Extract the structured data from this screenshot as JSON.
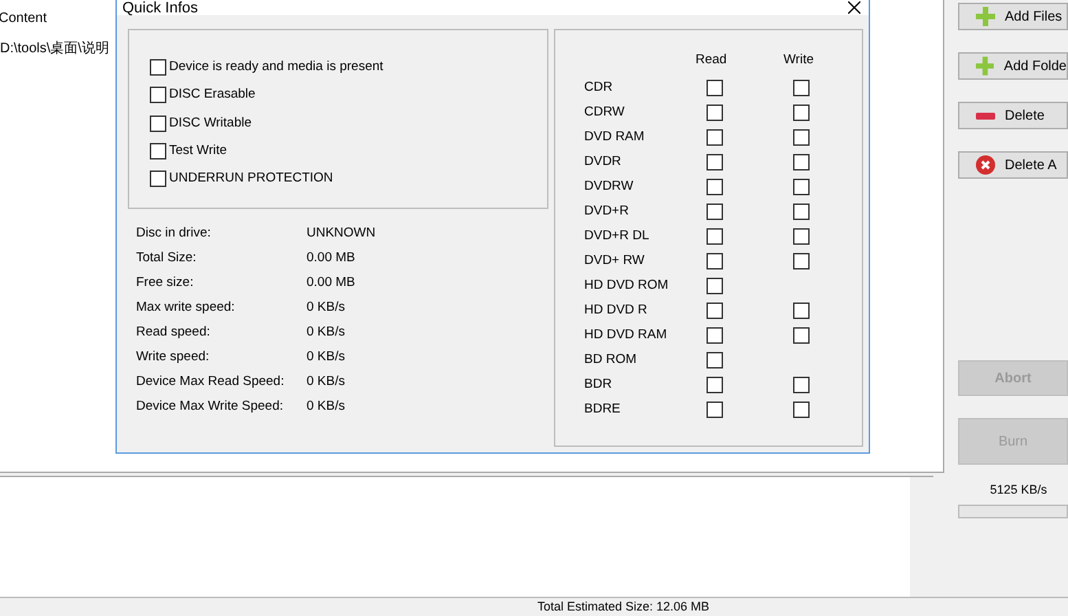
{
  "main_list": {
    "column_header": "Content",
    "rows": [
      "D:\\tools\\桌面\\说明"
    ]
  },
  "sidebar_buttons": [
    {
      "label": "Add Files",
      "kind": "add"
    },
    {
      "label": "Add Folde",
      "kind": "add"
    },
    {
      "label": "Delete",
      "kind": "delete"
    },
    {
      "label": "Delete A",
      "kind": "clear"
    }
  ],
  "action_buttons": [
    {
      "label": "Abort",
      "disabled": true
    },
    {
      "label": "Burn",
      "disabled": true
    }
  ],
  "speed": "5125 KB/s",
  "progress": {
    "level": 0
  },
  "status_bar": {
    "total": "Total Estimated Size: 12.06 MB"
  },
  "dialog": {
    "title": "Quick Infos",
    "flags": [
      {
        "label": "Device is ready and media is present",
        "checked": false
      },
      {
        "label": "DISC Erasable",
        "checked": false
      },
      {
        "label": "DISC Writable",
        "checked": false
      },
      {
        "label": "Test Write",
        "checked": false
      },
      {
        "label": "UNDERRUN PROTECTION",
        "checked": false
      }
    ],
    "info": [
      {
        "label": "Disc in drive:",
        "value": "UNKNOWN"
      },
      {
        "label": "Total Size:",
        "value": "0.00 MB"
      },
      {
        "label": "Free size:",
        "value": "0.00 MB"
      },
      {
        "label": "Max write speed:",
        "value": "0 KB/s"
      },
      {
        "label": "Read speed:",
        "value": "0 KB/s"
      },
      {
        "label": "Write speed:",
        "value": "0 KB/s"
      },
      {
        "label": "Device Max Read Speed:",
        "value": "0 KB/s"
      },
      {
        "label": "Device Max Write Speed:",
        "value": "0 KB/s"
      }
    ],
    "media_headers": [
      "Read",
      "Write"
    ],
    "media": [
      {
        "name": "CDR",
        "read": {
          "checked": false
        },
        "write": {
          "checked": false
        }
      },
      {
        "name": "CDRW",
        "read": {
          "checked": false
        },
        "write": {
          "checked": false
        }
      },
      {
        "name": "DVD RAM",
        "read": {
          "checked": false
        },
        "write": {
          "checked": false
        }
      },
      {
        "name": "DVDR",
        "read": {
          "checked": false
        },
        "write": {
          "checked": false
        }
      },
      {
        "name": "DVDRW",
        "read": {
          "checked": false
        },
        "write": {
          "checked": false
        }
      },
      {
        "name": "DVD+R",
        "read": {
          "checked": false
        },
        "write": {
          "checked": false
        }
      },
      {
        "name": "DVD+R DL",
        "read": {
          "checked": false
        },
        "write": {
          "checked": false
        }
      },
      {
        "name": "DVD+ RW",
        "read": {
          "checked": false
        },
        "write": {
          "checked": false
        }
      },
      {
        "name": "HD DVD ROM",
        "read": {
          "checked": false
        }
      },
      {
        "name": "HD DVD R",
        "read": {
          "checked": false
        },
        "write": {
          "checked": false
        }
      },
      {
        "name": "HD DVD RAM",
        "read": {
          "checked": false
        },
        "write": {
          "checked": false
        }
      },
      {
        "name": "BD ROM",
        "read": {
          "checked": false
        }
      },
      {
        "name": "BDR",
        "read": {
          "checked": false
        },
        "write": {
          "checked": false
        }
      },
      {
        "name": "BDRE",
        "read": {
          "checked": false
        },
        "write": {
          "checked": false
        }
      }
    ]
  }
}
